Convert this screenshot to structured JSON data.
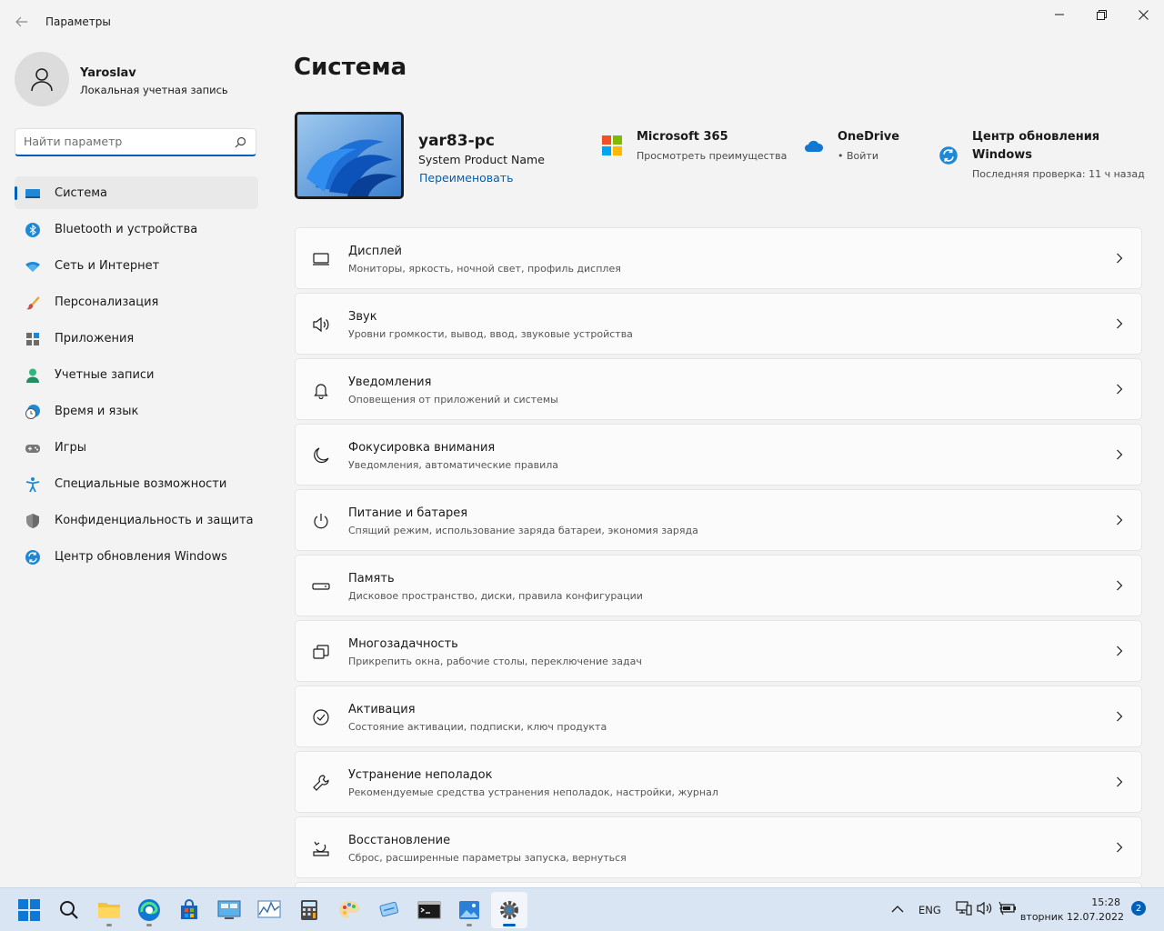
{
  "window": {
    "title": "Параметры"
  },
  "profile": {
    "name": "Yaroslav",
    "account_type": "Локальная учетная запись"
  },
  "search": {
    "placeholder": "Найти параметр",
    "value": ""
  },
  "sidebar": {
    "items": [
      {
        "label": "Система",
        "icon": "system-icon",
        "active": true
      },
      {
        "label": "Bluetooth и устройства",
        "icon": "bluetooth-icon",
        "active": false
      },
      {
        "label": "Сеть и Интернет",
        "icon": "wifi-icon",
        "active": false
      },
      {
        "label": "Персонализация",
        "icon": "brush-icon",
        "active": false
      },
      {
        "label": "Приложения",
        "icon": "apps-icon",
        "active": false
      },
      {
        "label": "Учетные записи",
        "icon": "account-icon",
        "active": false
      },
      {
        "label": "Время и язык",
        "icon": "time-language-icon",
        "active": false
      },
      {
        "label": "Игры",
        "icon": "gamepad-icon",
        "active": false
      },
      {
        "label": "Специальные возможности",
        "icon": "accessibility-icon",
        "active": false
      },
      {
        "label": "Конфиденциальность и защита",
        "icon": "shield-icon",
        "active": false
      },
      {
        "label": "Центр обновления Windows",
        "icon": "windows-update-icon",
        "active": false
      }
    ]
  },
  "main": {
    "title": "Система",
    "pc": {
      "name": "yar83-pc",
      "model": "System Product Name",
      "rename_link": "Переименовать"
    },
    "tiles": {
      "m365": {
        "title": "Microsoft 365",
        "subtitle": "Просмотреть преимущества"
      },
      "onedrive": {
        "title": "OneDrive",
        "subtitle": "• Войти"
      },
      "update": {
        "title_line1": "Центр обновления",
        "title_line2": "Windows",
        "subtitle": "Последняя проверка: 11 ч назад"
      }
    },
    "settings": [
      {
        "title": "Дисплей",
        "subtitle": "Мониторы, яркость, ночной свет, профиль дисплея",
        "icon": "display-icon"
      },
      {
        "title": "Звук",
        "subtitle": "Уровни громкости, вывод, ввод, звуковые устройства",
        "icon": "speaker-icon"
      },
      {
        "title": "Уведомления",
        "subtitle": "Оповещения от приложений и системы",
        "icon": "bell-icon"
      },
      {
        "title": "Фокусировка внимания",
        "subtitle": "Уведомления, автоматические правила",
        "icon": "moon-icon"
      },
      {
        "title": "Питание и батарея",
        "subtitle": "Спящий режим, использование заряда батареи, экономия заряда",
        "icon": "power-icon"
      },
      {
        "title": "Память",
        "subtitle": "Дисковое пространство, диски, правила конфигурации",
        "icon": "storage-icon"
      },
      {
        "title": "Многозадачность",
        "subtitle": "Прикрепить окна, рабочие столы, переключение задач",
        "icon": "multitasking-icon"
      },
      {
        "title": "Активация",
        "subtitle": "Состояние активации, подписки, ключ продукта",
        "icon": "activation-check-icon"
      },
      {
        "title": "Устранение неполадок",
        "subtitle": "Рекомендуемые средства устранения неполадок, настройки, журнал",
        "icon": "wrench-icon"
      },
      {
        "title": "Восстановление",
        "subtitle": "Сброс, расширенные параметры запуска, вернуться",
        "icon": "recovery-icon"
      }
    ]
  },
  "taskbar": {
    "language": "ENG",
    "time": "15:28",
    "date": "вторник 12.07.2022",
    "notification_count": "2"
  },
  "colors": {
    "accent": "#005fb8",
    "background": "#f3f3f3",
    "card": "#fbfbfb",
    "taskbar": "#dae5f3"
  }
}
